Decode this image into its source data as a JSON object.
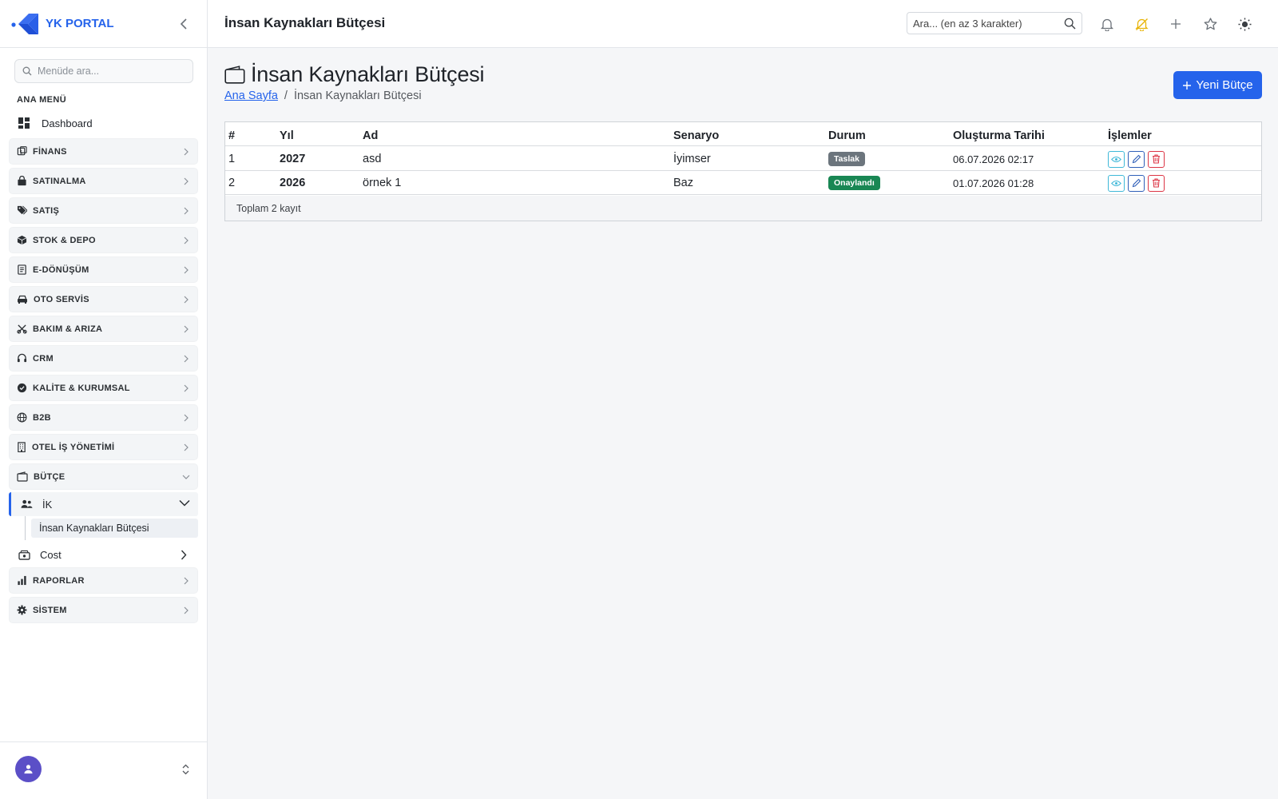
{
  "brand": {
    "name": "YK PORTAL",
    "accent": "#2563eb"
  },
  "sidebar": {
    "search_placeholder": "Menüde ara...",
    "section_title": "ANA MENÜ",
    "dashboard_label": "Dashboard",
    "groups": [
      {
        "label": "FİNANS",
        "icon": "finance-icon"
      },
      {
        "label": "SATINALMA",
        "icon": "shopping-bag-icon"
      },
      {
        "label": "SATIŞ",
        "icon": "tags-icon"
      },
      {
        "label": "STOK & DEPO",
        "icon": "box-icon"
      },
      {
        "label": "E-DÖNÜŞÜM",
        "icon": "document-icon"
      },
      {
        "label": "OTO SERVİS",
        "icon": "car-icon"
      },
      {
        "label": "BAKIM & ARIZA",
        "icon": "tools-icon"
      },
      {
        "label": "CRM",
        "icon": "headset-icon"
      },
      {
        "label": "KALİTE & KURUMSAL",
        "icon": "badge-check-icon"
      },
      {
        "label": "B2B",
        "icon": "globe-icon"
      },
      {
        "label": "OTEL İŞ YÖNETİMİ",
        "icon": "building-icon"
      },
      {
        "label": "BÜTÇE",
        "icon": "wallet-icon",
        "expanded": true
      },
      {
        "label": "RAPORLAR",
        "icon": "bar-chart-icon"
      },
      {
        "label": "SİSTEM",
        "icon": "gear-icon"
      }
    ],
    "ik": {
      "label": "İK",
      "icon": "users-icon",
      "expanded": true
    },
    "ik_children": [
      "İnsan Kaynakları Bütçesi"
    ],
    "cost": {
      "label": "Cost",
      "icon": "cash-register-icon"
    }
  },
  "header": {
    "title": "İnsan Kaynakları Bütçesi",
    "search_placeholder": "Ara... (en az 3 karakter)",
    "icons": [
      "bell-icon",
      "bell-off-icon",
      "plus-icon",
      "star-icon",
      "sun-icon"
    ]
  },
  "main": {
    "title": "İnsan Kaynakları Bütçesi",
    "breadcrumb": {
      "home": "Ana Sayfa",
      "separator": "/",
      "current": "İnsan Kaynakları Bütçesi"
    },
    "new_button": "Yeni Bütçe",
    "table": {
      "columns": [
        "#",
        "Yıl",
        "Ad",
        "Senaryo",
        "Durum",
        "Oluşturma Tarihi",
        "İşlemler"
      ],
      "rows": [
        {
          "no": "1",
          "year": "2027",
          "name": "asd",
          "scenario": "İyimser",
          "status": "Taslak",
          "status_color": "#6c757d",
          "created": "06.07.2026 02:17"
        },
        {
          "no": "2",
          "year": "2026",
          "name": "örnek 1",
          "scenario": "Baz",
          "status": "Onaylandı",
          "status_color": "#198754",
          "created": "01.07.2026 01:28"
        }
      ],
      "footer": "Toplam 2 kayıt"
    }
  }
}
